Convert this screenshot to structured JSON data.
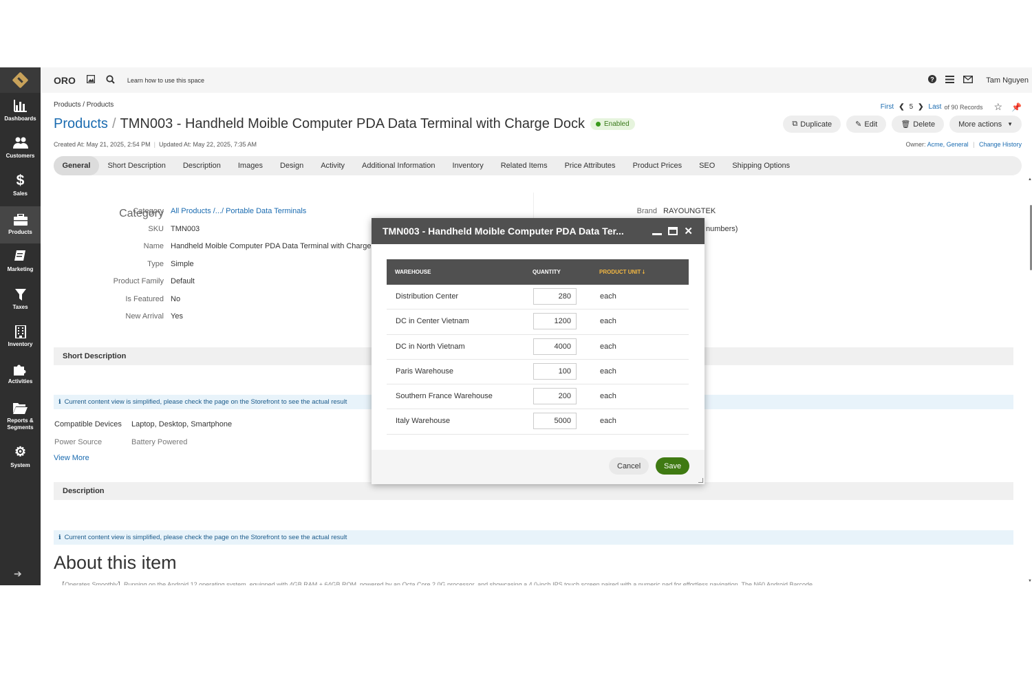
{
  "topbar": {
    "brand": "ORO",
    "learn": "Learn how to use this space",
    "user": "Tam Nguyen"
  },
  "sidebar": {
    "items": [
      {
        "label": "Dashboards",
        "icon": "bar-chart-icon"
      },
      {
        "label": "Customers",
        "icon": "users-icon"
      },
      {
        "label": "Sales",
        "icon": "dollar-icon"
      },
      {
        "label": "Products",
        "icon": "briefcase-icon"
      },
      {
        "label": "Marketing",
        "icon": "note-icon"
      },
      {
        "label": "Taxes",
        "icon": "filter-icon"
      },
      {
        "label": "Inventory",
        "icon": "building-icon"
      },
      {
        "label": "Activities",
        "icon": "puzzle-icon"
      },
      {
        "label": "Reports & Segments",
        "icon": "folder-icon"
      },
      {
        "label": "System",
        "icon": "gear-icon"
      }
    ]
  },
  "page": {
    "breadcrumb": "Products / Products",
    "pager": {
      "first": "First",
      "current": "5",
      "last": "Last",
      "total": "of 90 Records"
    },
    "title_link": "Products",
    "title_sep": "/",
    "title": "TMN003 - Handheld Moible Computer PDA Data Terminal with Charge Dock",
    "status": "Enabled",
    "actions": {
      "duplicate": "Duplicate",
      "edit": "Edit",
      "delete": "Delete",
      "more": "More actions"
    },
    "created": "Created At: May 21, 2025, 2:54 PM",
    "updated": "Updated At: May 22, 2025, 7:35 AM",
    "owner_label": "Owner:",
    "owner_value": "Acme, General",
    "change_history": "Change History"
  },
  "tabs": [
    "General",
    "Short Description",
    "Description",
    "Images",
    "Design",
    "Activity",
    "Additional Information",
    "Inventory",
    "Related Items",
    "Price Attributes",
    "Product Prices",
    "SEO",
    "Shipping Options"
  ],
  "general": {
    "category_label": "Category",
    "category_value": "All Products /.../ Portable Data Terminals",
    "sku_label": "SKU",
    "sku_value": "TMN003",
    "name_label": "Name",
    "name_value": "Handheld Moible Computer PDA Data Terminal with Charge Dock",
    "type_label": "Type",
    "type_value": "Simple",
    "family_label": "Product Family",
    "family_value": "Default",
    "featured_label": "Is Featured",
    "featured_value": "No",
    "arrival_label": "New Arrival",
    "arrival_value": "Yes",
    "brand_label": "Brand",
    "brand_value": "RAYOUNGTEK",
    "right_partial": "numbers)"
  },
  "short_description": {
    "heading": "Short Description",
    "notice": "Current content view is simplified, please check the page on the Storefront to see the actual result",
    "rows": [
      {
        "k": "Compatible Devices",
        "v": "Laptop, Desktop, Smartphone"
      },
      {
        "k": "Power Source",
        "v": "Battery Powered"
      }
    ],
    "view_more": "View More"
  },
  "description": {
    "heading": "Description",
    "notice": "Current content view is simplified, please check the page on the Storefront to see the actual result",
    "about": "About this item",
    "text": "【Operates Smoothly】Running on the Android 12 operating system, equipped with 4GB RAM + 64GB ROM, powered by an Octa Core 2.0G processor, and showcasing a 4.0-inch IPS touch screen paired with a numeric pad for effortless navigation. The N60 Android Barcode"
  },
  "dialog": {
    "title": "TMN003 - Handheld Moible Computer PDA Data Ter...",
    "columns": {
      "warehouse": "WAREHOUSE",
      "quantity": "QUANTITY",
      "unit": "PRODUCT UNIT"
    },
    "rows": [
      {
        "warehouse": "Distribution Center",
        "quantity": "280",
        "unit": "each"
      },
      {
        "warehouse": "DC in Center Vietnam",
        "quantity": "1200",
        "unit": "each"
      },
      {
        "warehouse": "DC in North Vietnam",
        "quantity": "4000",
        "unit": "each"
      },
      {
        "warehouse": "Paris Warehouse",
        "quantity": "100",
        "unit": "each"
      },
      {
        "warehouse": "Southern France Warehouse",
        "quantity": "200",
        "unit": "each"
      },
      {
        "warehouse": "Italy Warehouse",
        "quantity": "5000",
        "unit": "each"
      }
    ],
    "cancel": "Cancel",
    "save": "Save"
  },
  "colors": {
    "sidebar": "#2f2f2f",
    "link": "#1a6bb0",
    "save": "#3f7a12",
    "dialog_header": "#505050",
    "sort_accent": "#f5b942"
  }
}
